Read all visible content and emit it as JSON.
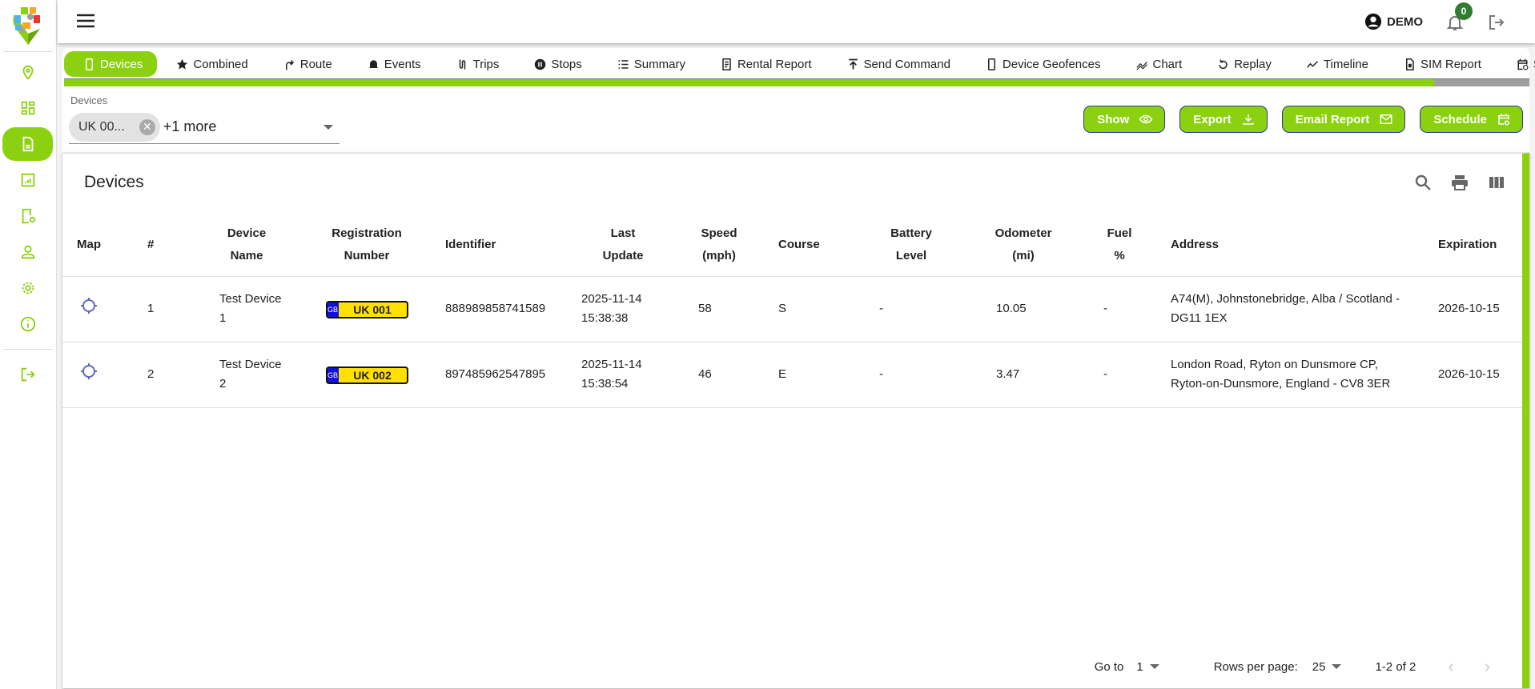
{
  "header": {
    "user": "DEMO",
    "notifications": "0"
  },
  "sidebar": {
    "items": [
      "map",
      "dashboard",
      "reports",
      "statistics",
      "device-settings",
      "users",
      "settings",
      "about",
      "logout"
    ],
    "active": "reports"
  },
  "tabs": [
    {
      "label": "Devices",
      "icon": "phone-icon",
      "active": true
    },
    {
      "label": "Combined",
      "icon": "star-icon"
    },
    {
      "label": "Route",
      "icon": "route-icon"
    },
    {
      "label": "Events",
      "icon": "alarm-icon"
    },
    {
      "label": "Trips",
      "icon": "trips-icon"
    },
    {
      "label": "Stops",
      "icon": "pause-icon"
    },
    {
      "label": "Summary",
      "icon": "list-icon"
    },
    {
      "label": "Rental Report",
      "icon": "receipt-icon"
    },
    {
      "label": "Send Command",
      "icon": "publish-icon"
    },
    {
      "label": "Device Geofences",
      "icon": "phone-icon"
    },
    {
      "label": "Chart",
      "icon": "chart-icon"
    },
    {
      "label": "Replay",
      "icon": "replay-icon"
    },
    {
      "label": "Timeline",
      "icon": "timeline-icon"
    },
    {
      "label": "SIM Report",
      "icon": "sim-icon"
    },
    {
      "label": "Scheduled",
      "icon": "calendar-icon"
    }
  ],
  "progress": 0.935,
  "filter": {
    "label": "Devices",
    "chip": "UK 00...",
    "more": "+1 more"
  },
  "actions": {
    "show": "Show",
    "export": "Export",
    "email": "Email Report",
    "schedule": "Schedule"
  },
  "table": {
    "title": "Devices",
    "headers": {
      "map": "Map",
      "num": "#",
      "name": "Device Name",
      "reg": "Registration Number",
      "id": "Identifier",
      "update": "Last Update",
      "speed": "Speed (mph)",
      "course": "Course",
      "battery": "Battery Level",
      "odo": "Odometer (mi)",
      "fuel": "Fuel %",
      "address": "Address",
      "exp": "Expiration"
    },
    "rows": [
      {
        "num": "1",
        "name": "Test Device 1",
        "country": "GB",
        "plate": "UK 001",
        "id": "888989858741589",
        "update": "2025-11-14 15:38:38",
        "speed": "58",
        "course": "S",
        "battery": "-",
        "odo": "10.05",
        "fuel": "-",
        "address": "A74(M), Johnstonebridge, Alba / Scotland - DG11 1EX",
        "exp": "2026-10-15"
      },
      {
        "num": "2",
        "name": "Test Device 2",
        "country": "GB",
        "plate": "UK 002",
        "id": "897485962547895",
        "update": "2025-11-14 15:38:54",
        "speed": "46",
        "course": "E",
        "battery": "-",
        "odo": "3.47",
        "fuel": "-",
        "address": "London Road, Ryton on Dunsmore CP, Ryton-on-Dunsmore, England - CV8 3ER",
        "exp": "2026-10-15"
      }
    ]
  },
  "pagination": {
    "goto_label": "Go to",
    "goto": "1",
    "rows_label": "Rows per page:",
    "rows": "25",
    "range": "1-2 of 2"
  },
  "colors": {
    "accent": "#8cd10f",
    "badge": "#2e7d32",
    "map_icon": "#5c6bc0"
  }
}
